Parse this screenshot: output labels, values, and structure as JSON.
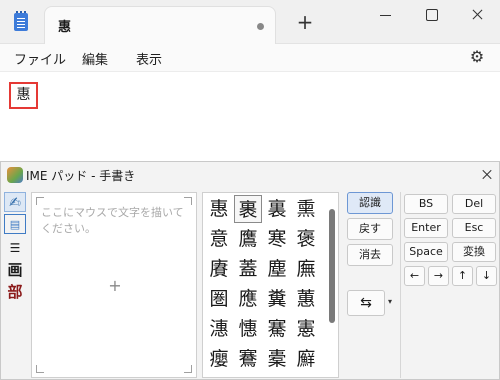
{
  "notepad": {
    "tab_title": "惠",
    "new_tab_label": "+",
    "menu": {
      "file": "ファイル",
      "edit": "編集",
      "view": "表示"
    },
    "document_text": "惠"
  },
  "ime_pad": {
    "title": "IME パッド - 手書き",
    "side_tools": {
      "handwriting": "✍",
      "list": "▤",
      "keyboard": "☰",
      "stroke": "画",
      "radical": "部"
    },
    "draw_hint": "ここにマウスで文字を描いてください。",
    "candidates": [
      [
        "惠",
        "裹",
        "裏",
        "熏"
      ],
      [
        "意",
        "鷹",
        "寒",
        "褒"
      ],
      [
        "賡",
        "蓋",
        "塵",
        "廡"
      ],
      [
        "圏",
        "應",
        "糞",
        "蕙"
      ],
      [
        "潓",
        "憓",
        "騫",
        "憲"
      ],
      [
        "癭",
        "鶱",
        "橐",
        "廯"
      ]
    ],
    "buttons": {
      "recognize": "認識",
      "back": "戻す",
      "clear": "消去",
      "mode_icon": "⇆"
    },
    "keys": {
      "bs": "BS",
      "del": "Del",
      "enter": "Enter",
      "esc": "Esc",
      "space": "Space",
      "convert": "変換",
      "left": "←",
      "right": "→",
      "up": "↑",
      "down": "↓"
    }
  }
}
